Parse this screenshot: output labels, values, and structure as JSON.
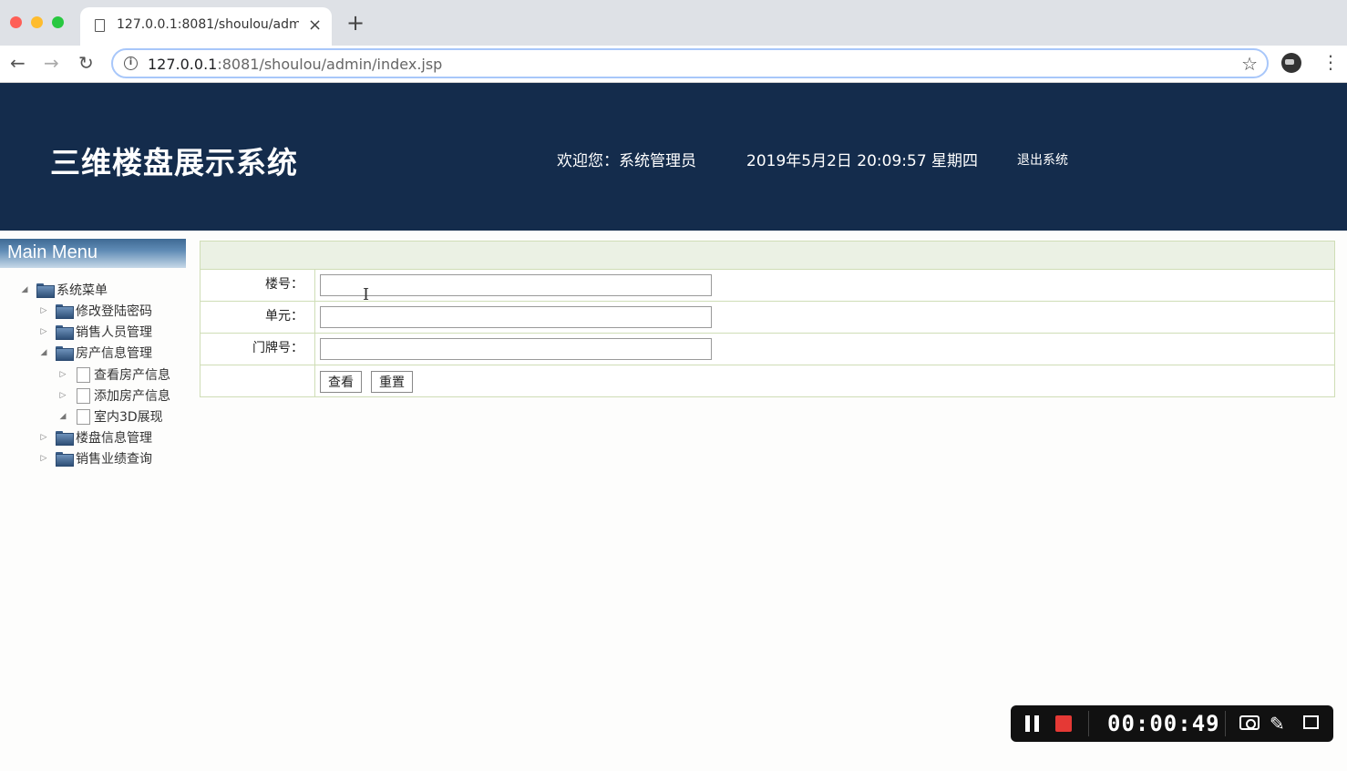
{
  "browser": {
    "tab_title": "127.0.0.1:8081/shoulou/admin/index.jsp",
    "url_host": "127.0.0.1",
    "url_rest": ":8081/shoulou/admin/index.jsp",
    "new_tab": "+",
    "close": "×"
  },
  "header": {
    "title": "三维楼盘展示系统",
    "welcome": "欢迎您：系统管理员",
    "datetime": "2019年5月2日 20:09:57 星期四",
    "logout": "退出系统"
  },
  "sidebar": {
    "heading": "Main Menu",
    "root": "系统菜单",
    "items": [
      {
        "label": "修改登陆密码"
      },
      {
        "label": "销售人员管理"
      },
      {
        "label": "房产信息管理"
      },
      {
        "label": "查看房产信息"
      },
      {
        "label": "添加房产信息"
      },
      {
        "label": "室内3D展现"
      },
      {
        "label": "楼盘信息管理"
      },
      {
        "label": "销售业绩查询"
      }
    ]
  },
  "form": {
    "fields": [
      {
        "label": "楼号：",
        "value": ""
      },
      {
        "label": "单元：",
        "value": ""
      },
      {
        "label": "门牌号：",
        "value": ""
      }
    ],
    "view_button": "查看",
    "reset_button": "重置"
  },
  "recorder": {
    "time": "00:00:49"
  }
}
